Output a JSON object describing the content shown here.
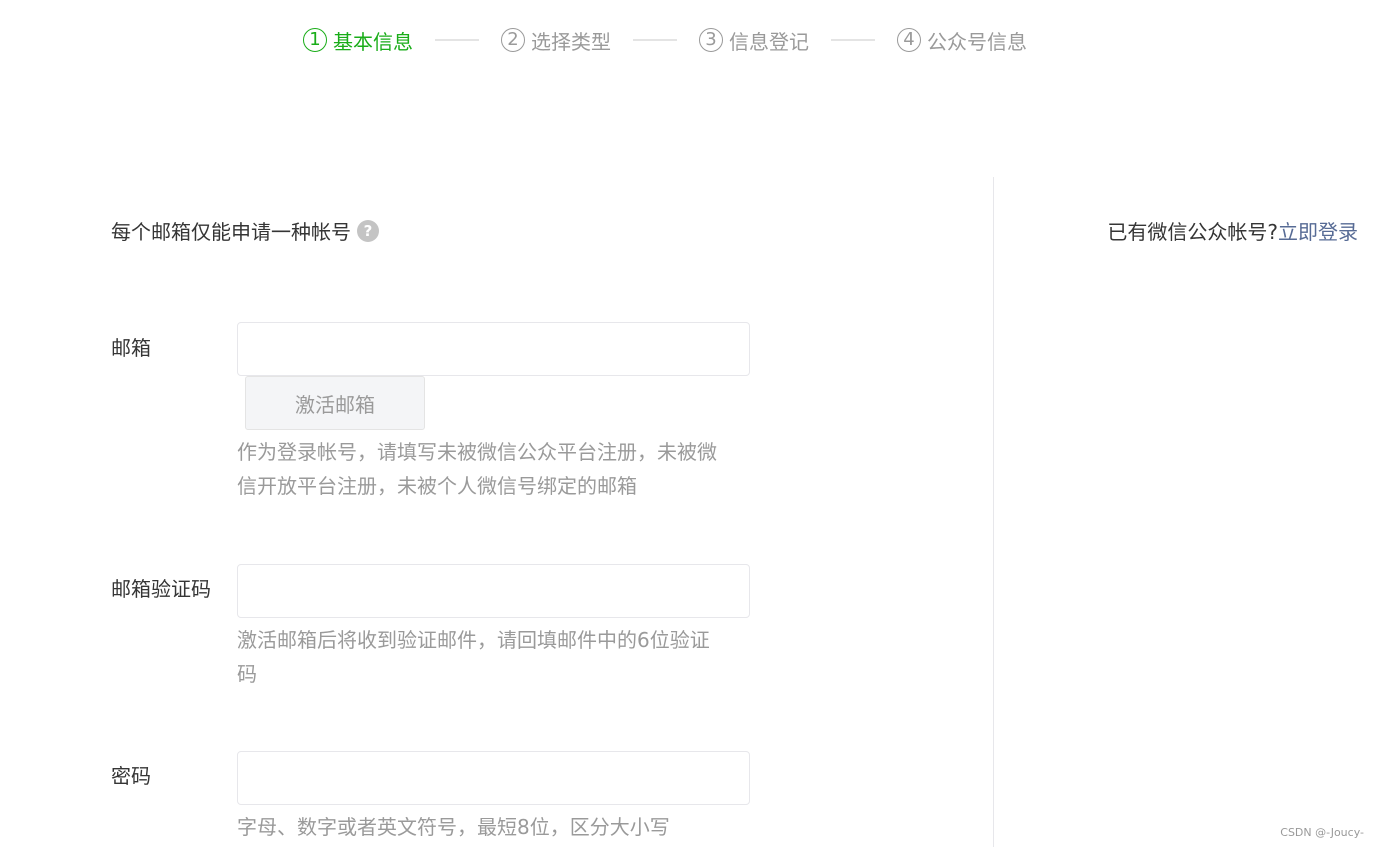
{
  "steps": [
    {
      "num": "1",
      "label": "基本信息"
    },
    {
      "num": "2",
      "label": "选择类型"
    },
    {
      "num": "3",
      "label": "信息登记"
    },
    {
      "num": "4",
      "label": "公众号信息"
    }
  ],
  "notice": {
    "text": "每个邮箱仅能申请一种帐号",
    "help_icon": "?"
  },
  "login_hint": {
    "text": "已有微信公众帐号?",
    "link": "立即登录"
  },
  "form": {
    "email": {
      "label": "邮箱",
      "value": "",
      "activate_button": "激活邮箱",
      "tip": "作为登录帐号，请填写未被微信公众平台注册，未被微信开放平台注册，未被个人微信号绑定的邮箱"
    },
    "code": {
      "label": "邮箱验证码",
      "value": "",
      "tip": "激活邮箱后将收到验证邮件，请回填邮件中的6位验证码"
    },
    "password": {
      "label": "密码",
      "value": "",
      "tip": "字母、数字或者英文符号，最短8位，区分大小写"
    }
  },
  "watermark": "CSDN @-Joucy-",
  "colors": {
    "active": "#1aad19",
    "link": "#576b95",
    "muted": "#9a9a9a"
  }
}
